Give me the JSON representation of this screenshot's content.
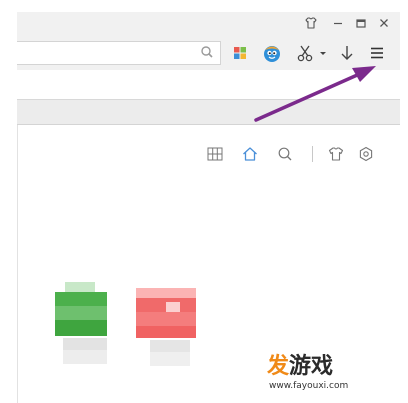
{
  "address_bar": {
    "value": "",
    "placeholder": ""
  },
  "icons": {
    "window": [
      "skin-icon",
      "minimize-icon",
      "maximize-icon",
      "close-icon"
    ],
    "toolbar": [
      "search-icon",
      "apps-grid-icon",
      "browser-mascot-icon",
      "scissors-icon",
      "dropdown-arrow-icon",
      "download-icon",
      "menu-icon"
    ],
    "content_toolbar": [
      "grid-view-icon",
      "home-icon",
      "search-icon",
      "shirt-icon",
      "settings-icon"
    ]
  },
  "colors": {
    "annotation_arrow": "#7b2a8c",
    "green_tile": "#4cb04c",
    "red_tile": "#f06a6a",
    "home_icon": "#4a8fd8",
    "watermark_accent": "#f08a18"
  },
  "watermark": {
    "brand_accent": "发",
    "brand_rest": "游戏",
    "url": "www.fayouxi.com"
  }
}
